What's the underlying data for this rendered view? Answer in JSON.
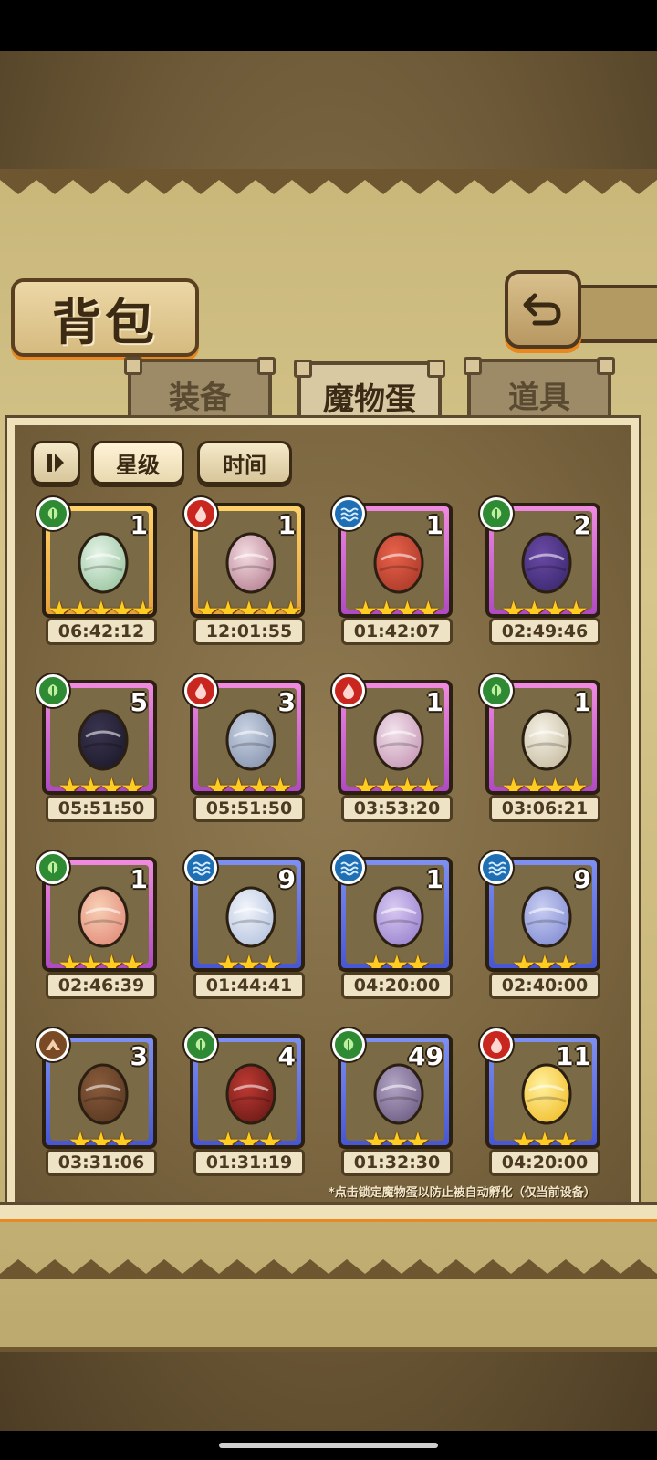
{
  "title": "背包",
  "tabs": [
    {
      "label": "装备",
      "active": false
    },
    {
      "label": "魔物蛋",
      "active": true
    },
    {
      "label": "道具",
      "active": false
    }
  ],
  "sort": {
    "toggle_icon": "sort-direction-icon",
    "star_label": "星级",
    "time_label": "时间"
  },
  "eggs": [
    {
      "element": "leaf",
      "frame": "gold",
      "count": "1",
      "stars": 5,
      "timer": "06:42:12"
    },
    {
      "element": "fire",
      "frame": "gold",
      "count": "1",
      "stars": 5,
      "timer": "12:01:55"
    },
    {
      "element": "water",
      "frame": "purple",
      "count": "1",
      "stars": 4,
      "timer": "01:42:07"
    },
    {
      "element": "leaf",
      "frame": "purple",
      "count": "2",
      "stars": 4,
      "timer": "02:49:46"
    },
    {
      "element": "leaf",
      "frame": "purple",
      "count": "5",
      "stars": 4,
      "timer": "05:51:50"
    },
    {
      "element": "fire",
      "frame": "purple",
      "count": "3",
      "stars": 4,
      "timer": "05:51:50"
    },
    {
      "element": "fire",
      "frame": "purple",
      "count": "1",
      "stars": 4,
      "timer": "03:53:20"
    },
    {
      "element": "leaf",
      "frame": "purple",
      "count": "1",
      "stars": 4,
      "timer": "03:06:21"
    },
    {
      "element": "leaf",
      "frame": "purple",
      "count": "1",
      "stars": 4,
      "timer": "02:46:39"
    },
    {
      "element": "water",
      "frame": "blue",
      "count": "9",
      "stars": 3,
      "timer": "01:44:41"
    },
    {
      "element": "water",
      "frame": "blue",
      "count": "1",
      "stars": 3,
      "timer": "04:20:00"
    },
    {
      "element": "water",
      "frame": "blue",
      "count": "9",
      "stars": 3,
      "timer": "02:40:00"
    },
    {
      "element": "earth",
      "frame": "blue",
      "count": "3",
      "stars": 3,
      "timer": "03:31:06"
    },
    {
      "element": "leaf",
      "frame": "blue",
      "count": "4",
      "stars": 3,
      "timer": "01:31:19"
    },
    {
      "element": "leaf",
      "frame": "blue",
      "count": "49",
      "stars": 3,
      "timer": "01:32:30"
    },
    {
      "element": "fire",
      "frame": "blue",
      "count": "11",
      "stars": 3,
      "timer": "04:20:00"
    }
  ],
  "footnote": "*点击锁定魔物蛋以防止被自动孵化（仅当前设备）",
  "colors": {
    "accent_orange": "#e8881f",
    "frame_gold": "#ffd36a",
    "frame_purple": "#d46bd6",
    "frame_blue": "#5a6ae0"
  }
}
